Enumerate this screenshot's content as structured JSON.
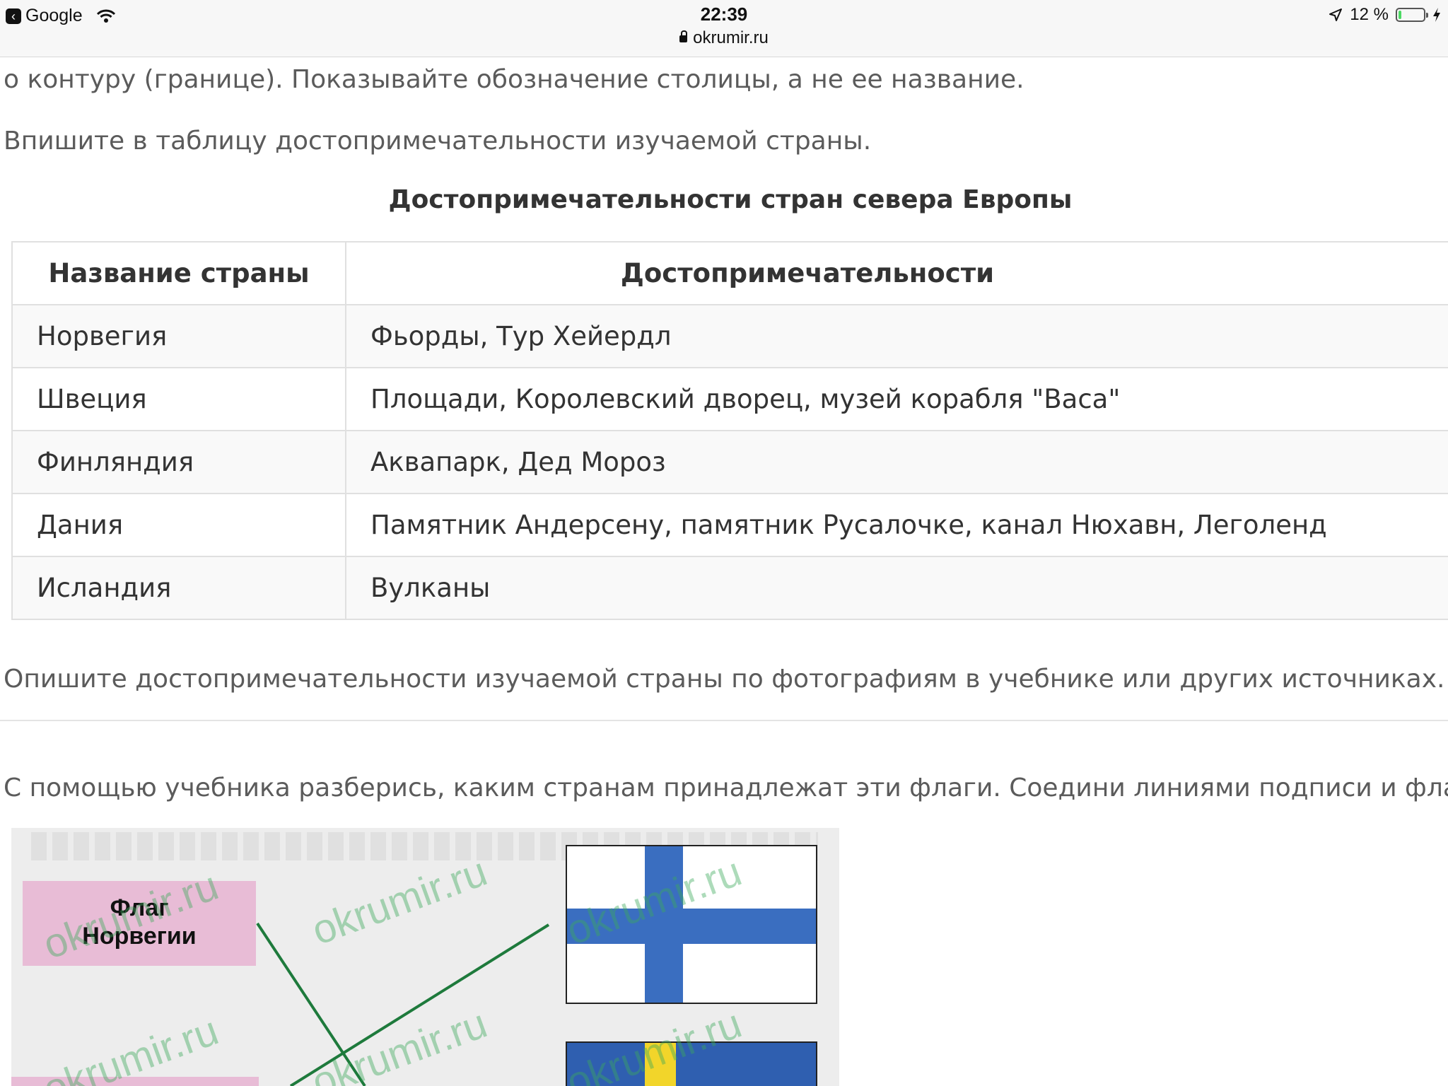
{
  "status_bar": {
    "back_app": "Google",
    "time": "22:39",
    "url": "okrumir.ru",
    "battery": "12 %",
    "battery_level": 0.12
  },
  "content": {
    "partial_line": "о контуру (границе). Показывайте обозначение столицы, а не ее название.",
    "instruction_table": "Впишите в таблицу достопримечательности изучаемой страны.",
    "table_title": "Достопримечательности стран севера Европы",
    "table": {
      "headers": [
        "Название страны",
        "Достопримечательности"
      ],
      "rows": [
        [
          "Норвегия",
          "Фьорды, Тур Хейердл"
        ],
        [
          "Швеция",
          "Площади, Королевский дворец, музей корабля \"Васа\""
        ],
        [
          "Финляндия",
          "Аквапарк, Дед Мороз"
        ],
        [
          "Дания",
          "Памятник Андерсену, памятник Русалочке, канал Нюхавн, Леголенд"
        ],
        [
          "Исландия",
          "Вулканы"
        ]
      ]
    },
    "instruction_photos": "Опишите достопримечательности изучаемой страны по фотографиям в учебнике или других источниках.",
    "instruction_flags": "С помощью учебника разберись, каким странам принадлежат эти флаги. Соедини линиями подписи и флаги.",
    "figure": {
      "label_1": "Флаг Норвегии",
      "watermark": "okrumir.ru"
    }
  },
  "colors": {
    "finland_blue": "#3a6ec0",
    "sweden_blue": "#2f5fb0",
    "sweden_yellow": "#f2d52a",
    "line_green": "#1e7a3c",
    "label_pink": "#e8bcd6"
  }
}
